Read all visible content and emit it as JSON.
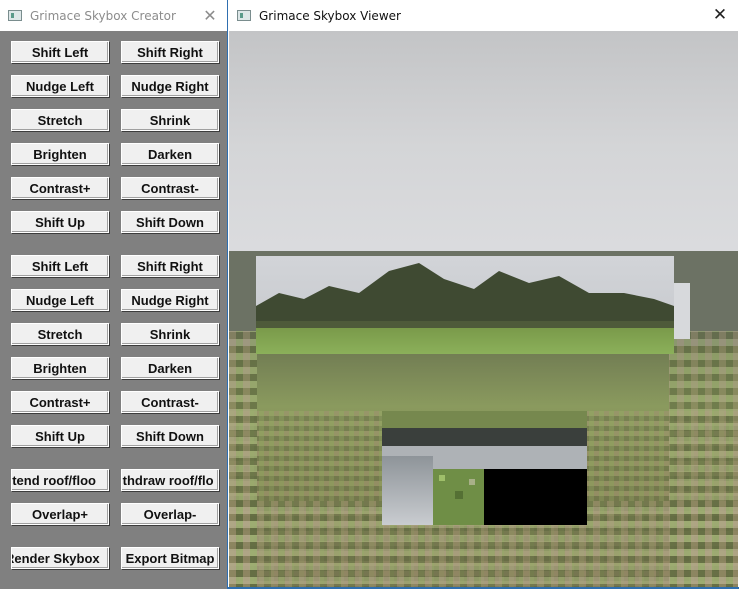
{
  "creator": {
    "title": "Grimace Skybox Creator",
    "buttons": {
      "g1": {
        "shift_left": "Shift Left",
        "shift_right": "Shift Right",
        "nudge_left": "Nudge Left",
        "nudge_right": "Nudge Right",
        "stretch": "Stretch",
        "shrink": "Shrink",
        "brighten": "Brighten",
        "darken": "Darken",
        "contrast_plus": "Contrast+",
        "contrast_minus": "Contrast-",
        "shift_up": "Shift Up",
        "shift_down": "Shift Down"
      },
      "g2": {
        "shift_left": "Shift Left",
        "shift_right": "Shift Right",
        "nudge_left": "Nudge Left",
        "nudge_right": "Nudge Right",
        "stretch": "Stretch",
        "shrink": "Shrink",
        "brighten": "Brighten",
        "darken": "Darken",
        "contrast_plus": "Contrast+",
        "contrast_minus": "Contrast-",
        "shift_up": "Shift Up",
        "shift_down": "Shift Down"
      },
      "extend_roof": "xtend roof/floo",
      "withdraw_roof": "ithdraw roof/flo",
      "overlap_plus": "Overlap+",
      "overlap_minus": "Overlap-",
      "render_skybox": "Render Skybox",
      "export_bitmap": "Export Bitmap"
    }
  },
  "viewer": {
    "title": "Grimace Skybox Viewer"
  },
  "colors": {
    "creator_bg": "#808080",
    "button_face": "#f0f0f0",
    "window_border": "#2f6fb0"
  }
}
